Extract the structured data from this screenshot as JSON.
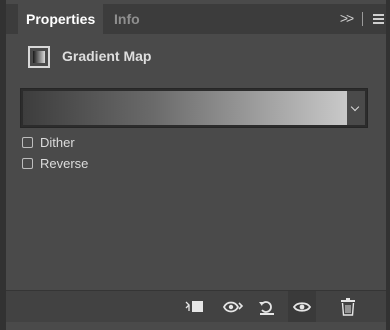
{
  "tabs": [
    {
      "label": "Properties",
      "active": true
    },
    {
      "label": "Info",
      "active": false
    }
  ],
  "tab_menu": {
    "collapse_glyph": ">>"
  },
  "adjustment": {
    "icon": "gradient-map-adjustment-icon",
    "title": "Gradient Map"
  },
  "gradient": {
    "colors": [
      "#3d3d3d",
      "#6a6a6a",
      "#c9c9c9"
    ]
  },
  "options": [
    {
      "label": "Dither",
      "checked": false
    },
    {
      "label": "Reverse",
      "checked": false
    }
  ],
  "toolbar": {
    "icons": [
      "clip-to-layer-icon",
      "view-previous-state-icon",
      "reset-defaults-icon",
      "toggle-visibility-icon",
      "delete-icon"
    ]
  },
  "colors": {
    "panel_bg": "#4a4a4a",
    "tabbar_bg": "#3c3c3c",
    "text": "#dcdcdc"
  }
}
